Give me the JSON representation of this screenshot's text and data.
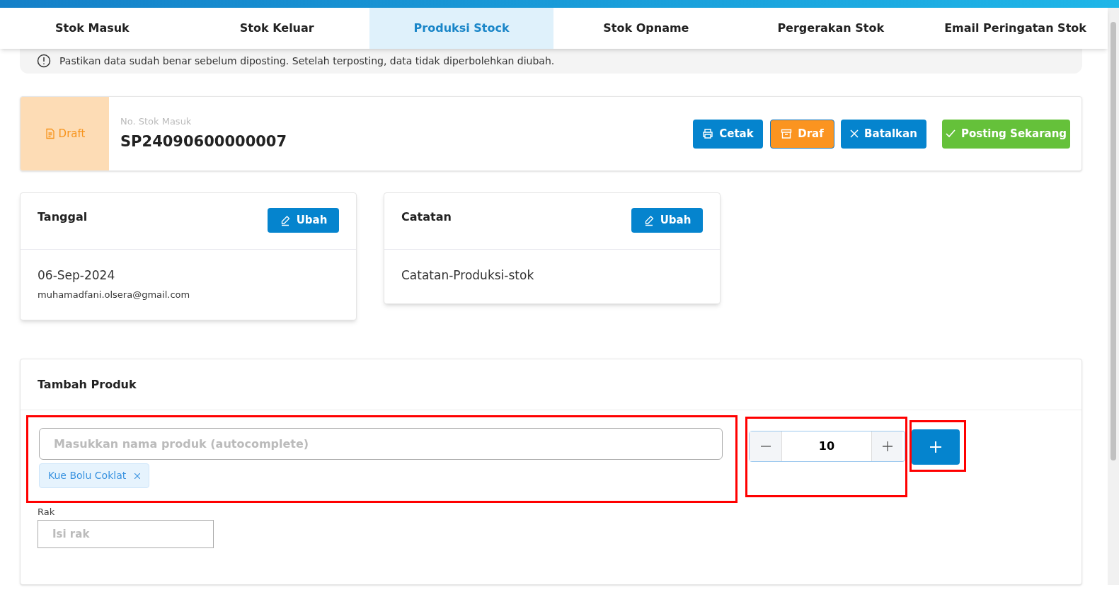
{
  "tabs": [
    {
      "label": "Stok Masuk",
      "selected": false
    },
    {
      "label": "Stok Keluar",
      "selected": false
    },
    {
      "label": "Produksi Stock",
      "selected": true
    },
    {
      "label": "Stok Opname",
      "selected": false
    },
    {
      "label": "Pergerakan Stok",
      "selected": false
    },
    {
      "label": "Email Peringatan Stok",
      "selected": false
    }
  ],
  "notice": "Pastikan data sudah benar sebelum diposting. Setelah terposting, data tidak diperbolehkan diubah.",
  "document": {
    "status": "Draft",
    "number_label": "No. Stok Masuk",
    "number": "SP24090600000007",
    "actions": [
      {
        "kind": "print",
        "label": "Cetak"
      },
      {
        "kind": "draft",
        "label": "Draf"
      },
      {
        "kind": "cancel",
        "label": "Batalkan"
      },
      {
        "kind": "post",
        "label": "Posting Sekarang"
      }
    ]
  },
  "cards": [
    {
      "title": "Tanggal",
      "button": "Ubah",
      "lines": [
        "06-Sep-2024",
        "muhamadfani.olsera@gmail.com"
      ]
    },
    {
      "title": "Catatan",
      "button": "Ubah",
      "lines": [
        "Catatan-Produksi-stok"
      ]
    }
  ],
  "add_product": {
    "title": "Tambah Produk",
    "product_placeholder": "Masukkan nama produk (autocomplete)",
    "chips": [
      "Kue Bolu Coklat"
    ],
    "quantity": "10",
    "rack_label": "Rak",
    "rack_placeholder": "Isi rak"
  }
}
